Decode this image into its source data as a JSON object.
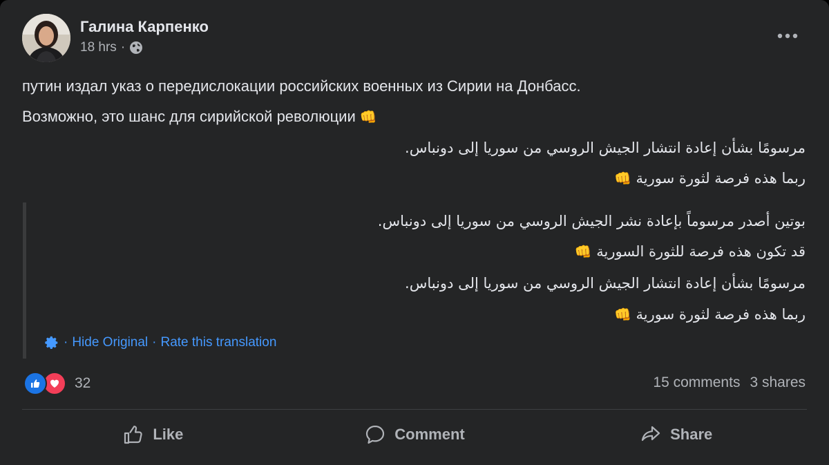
{
  "post": {
    "author": "Галина Карпенко",
    "time": "18 hrs",
    "meta_separator": "·",
    "privacy_icon": "globe-icon",
    "more_icon": "more-horizontal-icon"
  },
  "content": {
    "line1": "путин издал указ о передислокации российских военных из Сирии на Донбасс.",
    "line2": "Возможно, это шанс для сирийской революции",
    "arabic1": "مرسومًا بشأن إعادة انتشار الجيش الروسي من سوريا إلى دونباس.",
    "arabic2": "ربما هذه فرصة لثورة سورية",
    "emoji": "👊"
  },
  "original": {
    "line1": "بوتين أصدر مرسوماً بإعادة نشر الجيش الروسي من سوريا إلى دونباس.",
    "line2": "قد تكون هذه فرصة للثورة السورية",
    "line3": "مرسومًا بشأن إعادة انتشار الجيش الروسي من سوريا إلى دونباس.",
    "line4": "ربما هذه فرصة لثورة سورية"
  },
  "translation": {
    "hide_original": "Hide Original",
    "rate": "Rate this translation",
    "separator": "·"
  },
  "stats": {
    "reaction_count": "32",
    "comments": "15 comments",
    "shares": "3 shares"
  },
  "actions": {
    "like": "Like",
    "comment": "Comment",
    "share": "Share"
  },
  "colors": {
    "background": "#242526",
    "text": "#e4e6eb",
    "secondary": "#b0b3b8",
    "link": "#4599ff",
    "like_blue": "#1b74e4",
    "love_red": "#f33e58"
  }
}
